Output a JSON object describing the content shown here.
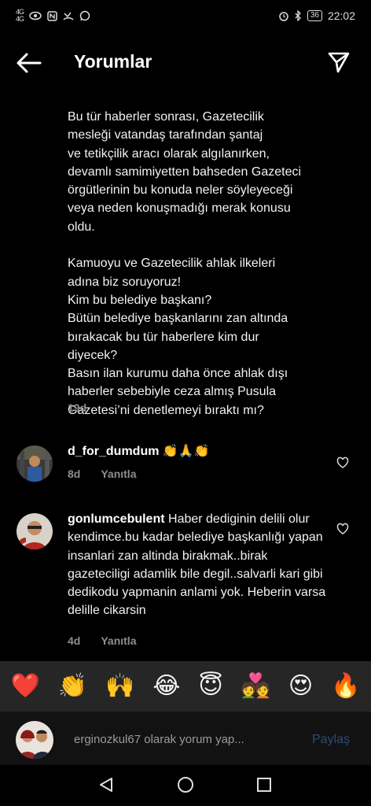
{
  "status_bar": {
    "signal_left": "4G\n4G",
    "battery": "36",
    "time": "22:02"
  },
  "header": {
    "title": "Yorumlar"
  },
  "caption": {
    "text": "Bu tür haberler sonrası, Gazetecilik\nmesleği vatandaş tarafından şantaj\nve tetikçilik aracı olarak algılanırken,\ndevamlı samimiyetten bahseden Gazeteci\nörgütlerinin bu konuda neler söyleyeceği\nveya neden konuşmadığı merak konusu\noldu.\n\nKamuoyu ve Gazetecilik ahlak ilkeleri\nadına biz soruyoruz!\nKim bu belediye başkanı?\nBütün belediye başkanlarını zan altında\nbırakacak bu tür haberlere kim dur\ndiyecek?\nBasın ilan kurumu daha önce ahlak dışı\nhaberler sebebiyle ceza almış Pusula\nGazetesi’ni denetlemeyi bıraktı mı?",
    "time": "19d"
  },
  "comments": [
    {
      "username": "d_for_dumdum",
      "text": " 👏🙏👏",
      "time": "8d",
      "reply_label": "Yanıtla"
    },
    {
      "username": "gonlumcebulent",
      "text": " Haber dediginin delili olur kendimce.bu kadar belediye başkanlığı yapan insanlari zan altinda birakmak..birak gazeteciligi adamlik bile degil..salvarli kari gibi dedikodu yapmanin anlami yok. Heberin varsa delille cikarsin",
      "time": "4d",
      "reply_label": "Yanıtla"
    }
  ],
  "emoji_bar": [
    "❤️",
    "👏",
    "🙌",
    "😂",
    "😇",
    "💑",
    "😍",
    "🔥"
  ],
  "comment_input": {
    "placeholder": "erginozkul67 olarak yorum yap...",
    "share_label": "Paylaş"
  },
  "colors": {
    "background": "#000000",
    "secondary_text": "#8e8e8e",
    "share_disabled": "#2b4d7a"
  }
}
